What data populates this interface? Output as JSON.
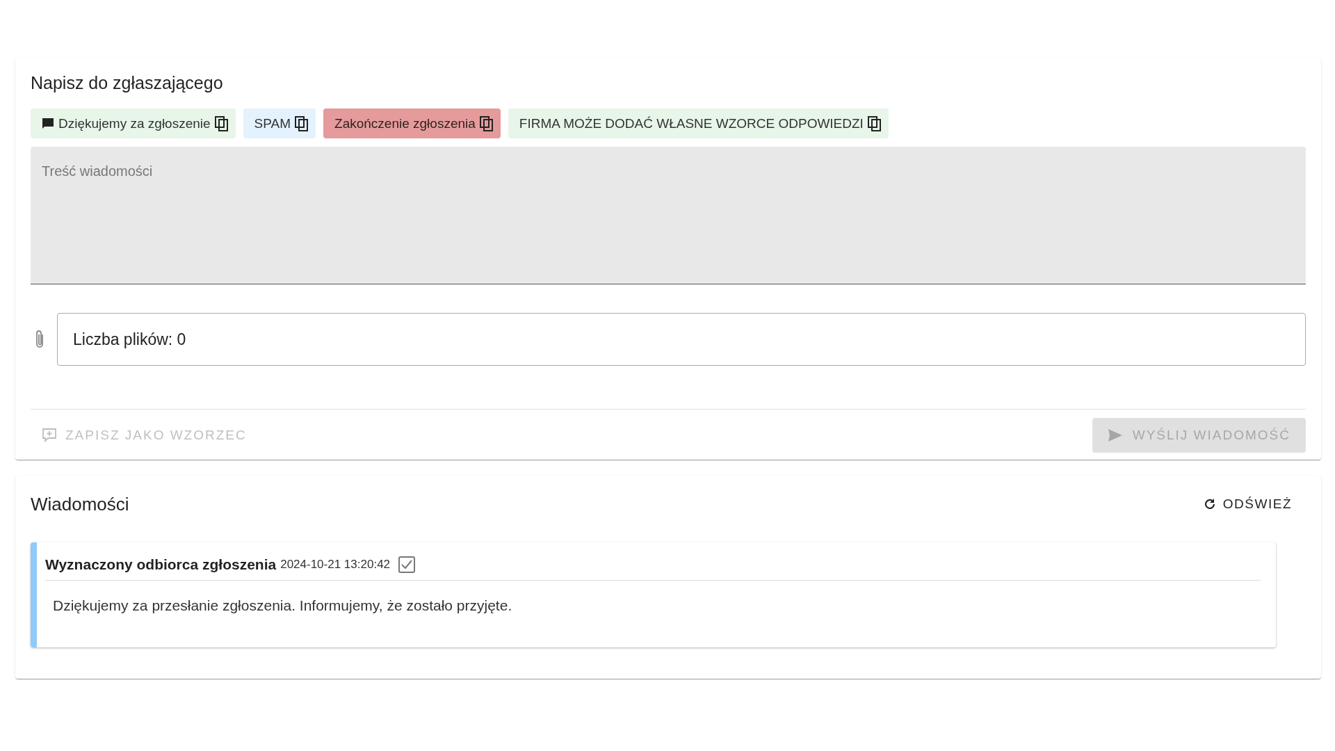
{
  "compose": {
    "title": "Napisz do zgłaszającego",
    "templates": [
      {
        "label": "Dziękujemy za zgłoszenie",
        "kind": "icon",
        "color": "#e8f5e9"
      },
      {
        "label": "SPAM",
        "kind": "plain",
        "color": "#e3f2fd"
      },
      {
        "label": "Zakończenie zgłoszenia",
        "kind": "plain",
        "color": "#e59b9b"
      },
      {
        "label": "FIRMA MOŻE DODAĆ WŁASNE WZORCE ODPOWIEDZI",
        "kind": "plain",
        "color": "#e8f5e9"
      }
    ],
    "message": {
      "placeholder": "Treść wiadomości"
    },
    "files": {
      "value": "Liczba plików: 0"
    },
    "save_button": {
      "label": "ZAPISZ JAKO WZORZEC",
      "disabled": true
    },
    "send_button": {
      "label": "WYŚLIJ WIADOMOŚĆ",
      "disabled": true
    }
  },
  "messages": {
    "title": "Wiadomości",
    "refresh": "ODŚWIEŻ",
    "items": [
      {
        "author": "Wyznaczony odbiorca zgłoszenia",
        "date": "2024-10-21 13:20:42",
        "checked": true,
        "text": "Dziękujemy za przesłanie zgłoszenia. Informujemy, że zostało przyjęte."
      }
    ]
  }
}
